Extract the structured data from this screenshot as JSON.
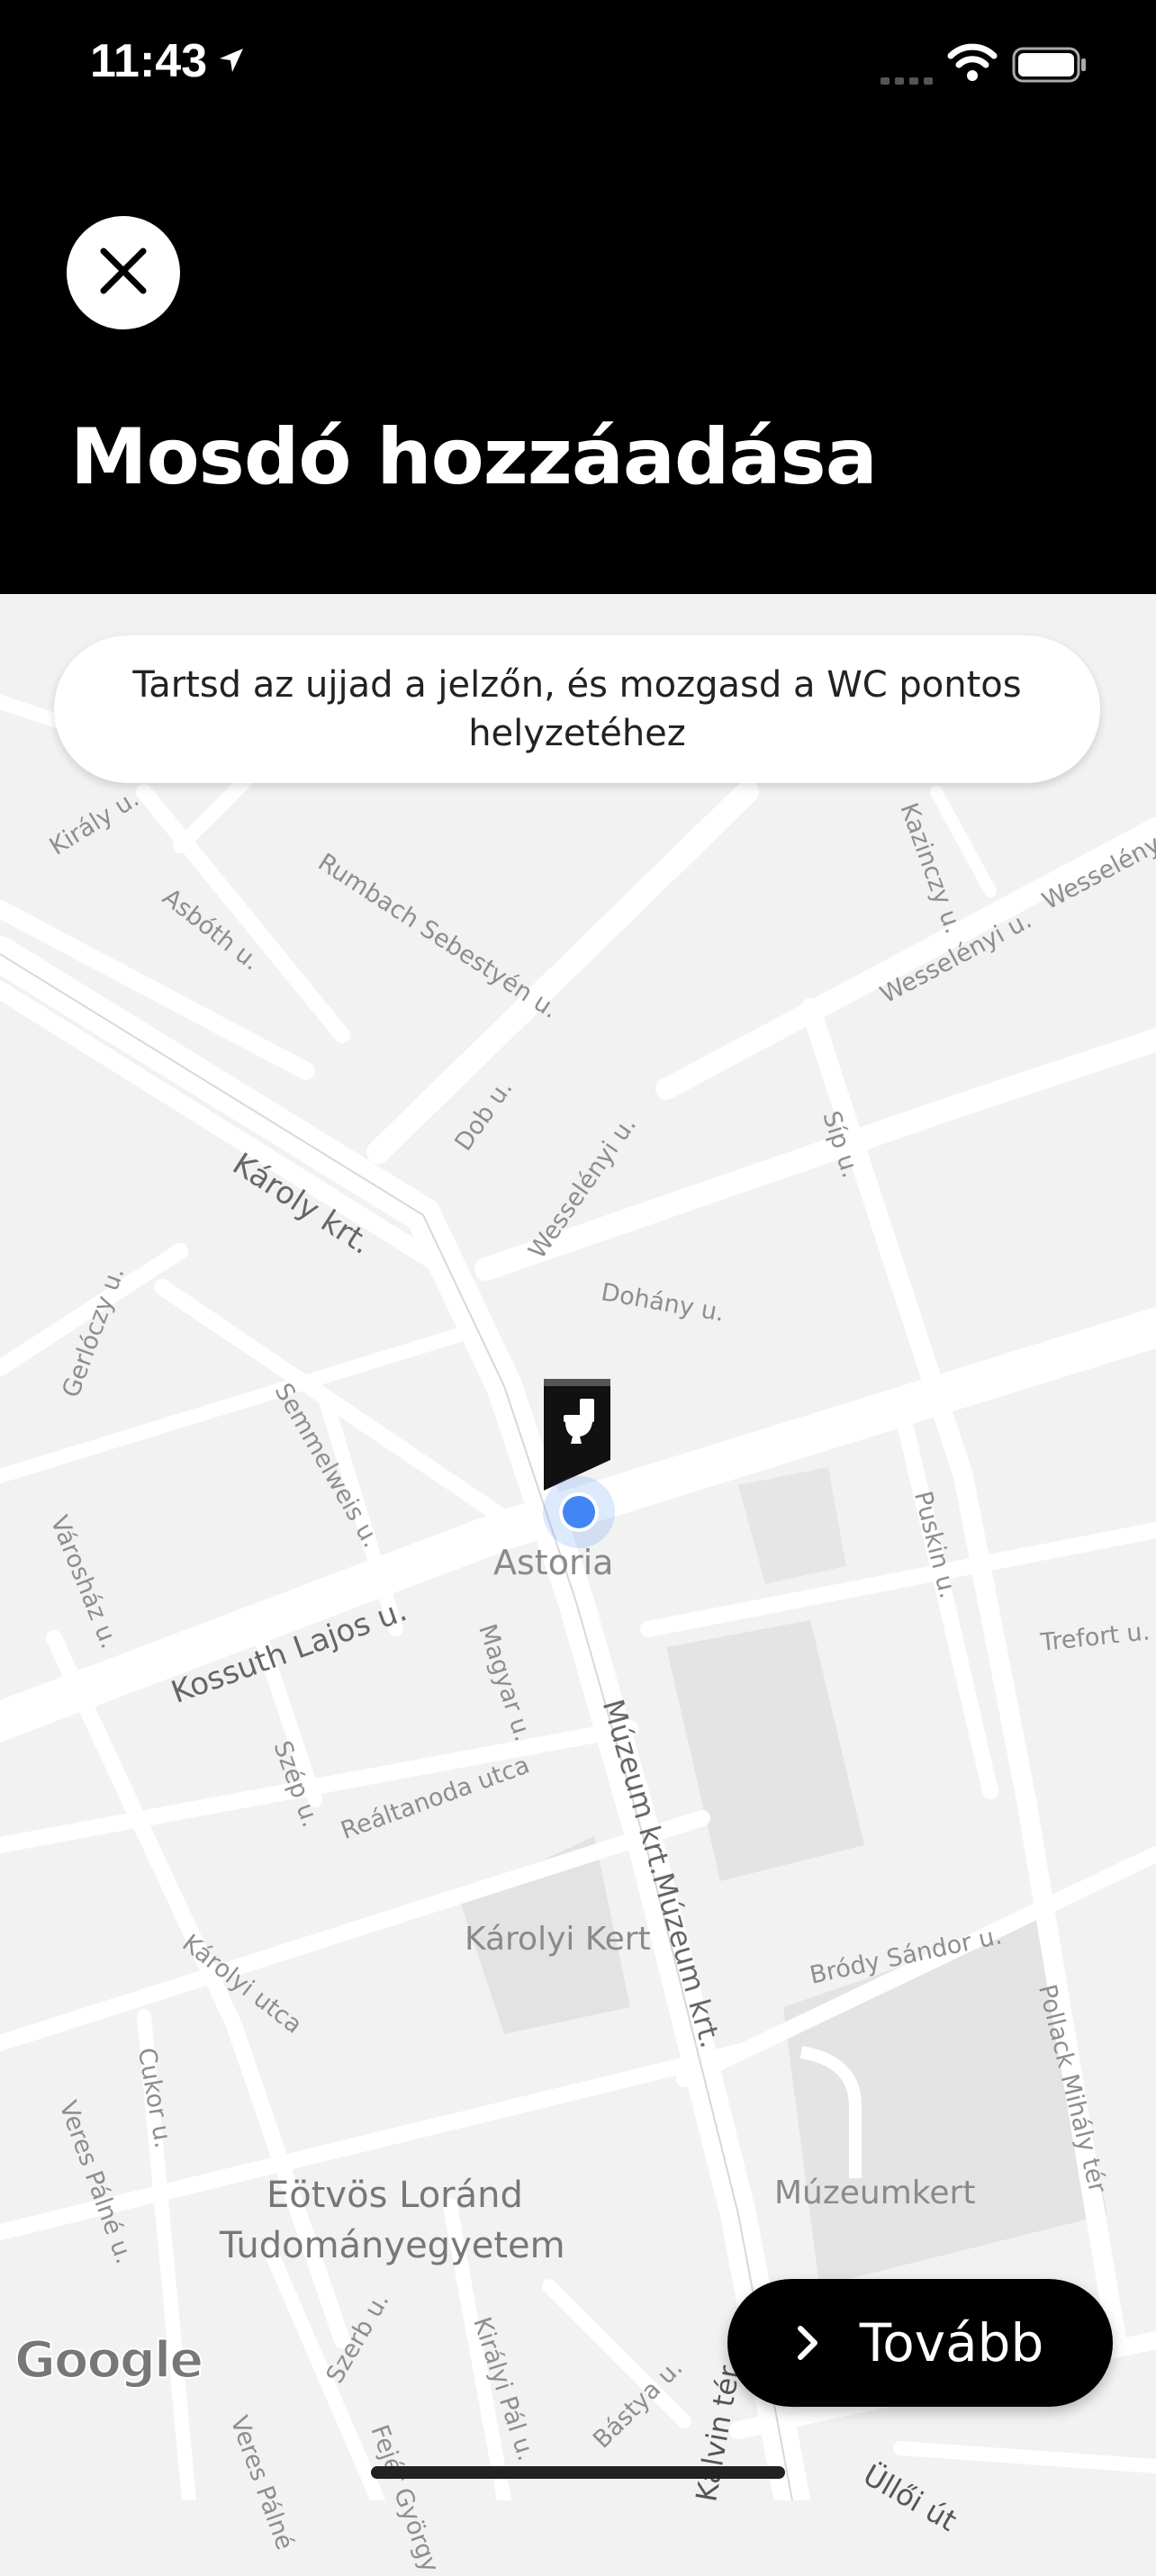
{
  "status_bar": {
    "time": "11:43",
    "icons": [
      "location-arrow-icon",
      "cellular-signal-icon",
      "wifi-icon",
      "battery-icon"
    ]
  },
  "header": {
    "close_icon": "close-icon",
    "title": "Mosdó hozzáadása"
  },
  "hint": {
    "text": "Tartsd az ujjad a jelzőn, és mozgasd a WC pontos helyzetéhez"
  },
  "map": {
    "pin_icon": "toilet-pin-icon",
    "labels": {
      "kiraly": "Király u.",
      "asboth": "Asbóth u.",
      "rumbach": "Rumbach Sebestyén u.",
      "kazinczy": "Kazinczy u.",
      "wesselenyi_1": "Wesselényi u.",
      "wesselenyi_2": "Wesselényi u.",
      "wesselenyi_3": "Wesselényi u.",
      "sip": "Síp u.",
      "dob": "Dob u.",
      "karoly_krt": "Károly krt.",
      "dohany": "Dohány u.",
      "semmelweis": "Semmelweis u.",
      "gerloczy": "Gerlóczy u.",
      "varoshaz": "Városház u.",
      "puskin": "Puskin u.",
      "astoria": "Astoria",
      "kossuth": "Kossuth Lajos u.",
      "trefort": "Trefort u.",
      "magyar": "Magyar u.",
      "muzeum_krt": "Múzeum krt.Múzeum krt.",
      "szep": "Szép u.",
      "realtanoda": "Reáltanoda utca",
      "brody": "Bródy Sándor u.",
      "karolyi_kert": "Károlyi Kert",
      "karolyi_utca": "Károlyi utca",
      "pollack": "Pollack Mihály tér",
      "cukor": "Cukor u.",
      "veres_palne": "Veres Pálné u.",
      "elte_1": "Eötvös Loránd",
      "elte_2": "Tudományegyetem",
      "muzeumkert": "Múzeumkert",
      "szerb": "Szerb u.",
      "kiralyi_pal": "Királyi Pál u.",
      "bastya": "Bástya u.",
      "kalvin": "Kálvin tér",
      "ulloi": "Üllői út",
      "veres_palne_2": "Veres Pálné",
      "fejer": "Fejér György"
    }
  },
  "attribution": "Google",
  "next_button": {
    "label": "Tovább",
    "icon": "chevron-right-icon"
  }
}
